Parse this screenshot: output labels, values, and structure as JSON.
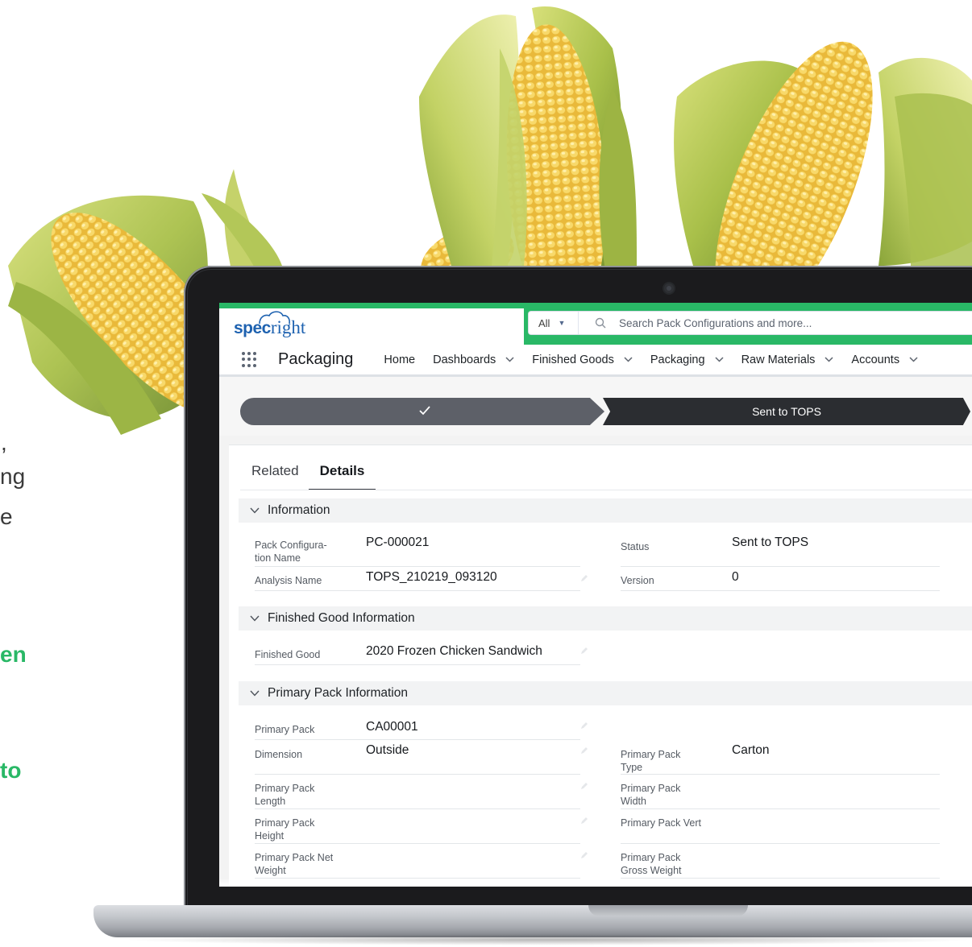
{
  "background_text": {
    "fragment_1": ",",
    "fragment_2": "ng",
    "fragment_3": "e",
    "fragment_4": "en",
    "fragment_5": "to"
  },
  "colors": {
    "brand_green": "#29b866",
    "logo_blue": "#1e62b0",
    "path_complete": "#5d6068",
    "path_current": "#2b2d31"
  },
  "header": {
    "logo_prefix": "spec",
    "logo_suffix": "right",
    "search": {
      "scope": "All",
      "scope_icon": "caret-down-icon",
      "icon": "search-icon",
      "placeholder": "Search Pack Configurations and more..."
    }
  },
  "nav": {
    "launcher_icon": "app-launcher-icon",
    "app_name": "Packaging",
    "items": [
      {
        "label": "Home",
        "has_menu": false
      },
      {
        "label": "Dashboards",
        "has_menu": true
      },
      {
        "label": "Finished Goods",
        "has_menu": true
      },
      {
        "label": "Packaging",
        "has_menu": true
      },
      {
        "label": "Raw Materials",
        "has_menu": true
      },
      {
        "label": "Accounts",
        "has_menu": true
      }
    ]
  },
  "path": {
    "completed_icon": "checkmark-icon",
    "current_label": "Sent to TOPS"
  },
  "tabs": [
    {
      "label": "Related",
      "active": false
    },
    {
      "label": "Details",
      "active": true
    }
  ],
  "sections": {
    "information": {
      "title": "Information",
      "fields": {
        "pack_config_name_label": "Pack Configura-\ntion Name",
        "pack_config_name_value": "PC-000021",
        "status_label": "Status",
        "status_value": "Sent to TOPS",
        "analysis_name_label": "Analysis Name",
        "analysis_name_value": "TOPS_210219_093120",
        "version_label": "Version",
        "version_value": "0"
      }
    },
    "finished_good_information": {
      "title": "Finished Good Information",
      "fields": {
        "finished_good_label": "Finished Good",
        "finished_good_value": "2020 Frozen Chicken Sandwich"
      }
    },
    "primary_pack_information": {
      "title": "Primary Pack Information",
      "fields": {
        "primary_pack_label": "Primary Pack",
        "primary_pack_value": "CA00001",
        "dimension_label": "Dimension",
        "dimension_value": "Outside",
        "primary_pack_type_label": "Primary Pack\nType",
        "primary_pack_type_value": "Carton",
        "primary_pack_length_label": "Primary Pack\nLength",
        "primary_pack_width_label": "Primary Pack\nWidth",
        "primary_pack_height_label": "Primary Pack\nHeight",
        "primary_pack_vert_label": "Primary Pack Vert",
        "primary_pack_net_weight_label": "Primary Pack Net\nWeight",
        "primary_pack_gross_weight_label": "Primary Pack\nGross Weight"
      }
    }
  }
}
